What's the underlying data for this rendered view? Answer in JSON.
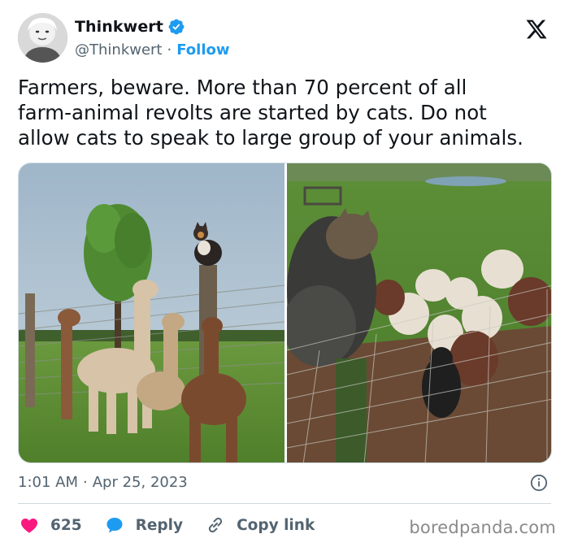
{
  "author": {
    "display_name": "Thinkwert",
    "handle": "@Thinkwert",
    "separator": "·",
    "follow_label": "Follow",
    "verified": true,
    "avatar_icon": "avatar-photo"
  },
  "brand": {
    "logo_icon": "x-logo-icon"
  },
  "tweet": {
    "lines": [
      "Farmers, beware.  More than 70 percent of all",
      "farm-animal revolts are started by cats. Do not",
      "allow cats to speak to large group of your animals."
    ]
  },
  "media": {
    "images": [
      {
        "name": "alpacas-with-cat-on-post-photo"
      },
      {
        "name": "cat-with-sheep-at-fence-photo"
      }
    ]
  },
  "meta": {
    "time": "1:01 AM",
    "separator": "·",
    "date": "Apr 25, 2023",
    "info_icon": "info-icon"
  },
  "actions": {
    "like_count": "625",
    "reply_label": "Reply",
    "copy_link_label": "Copy link"
  },
  "watermark": "boredpanda.com",
  "colors": {
    "accent": "#1d9bf0",
    "like": "#f91880",
    "text": "#0f1419",
    "secondary": "#536471"
  }
}
